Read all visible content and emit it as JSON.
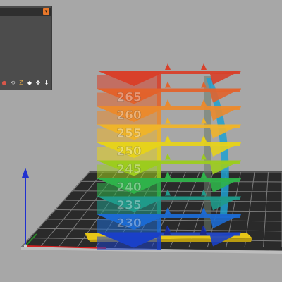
{
  "panel": {
    "dropdown_arrow_icon": "chevron-down-icon",
    "toolbar": [
      {
        "name": "object-icon"
      },
      {
        "name": "rotate-icon"
      },
      {
        "name": "scale-icon"
      },
      {
        "name": "cube-view-icon"
      },
      {
        "name": "move-icon"
      },
      {
        "name": "arrow-down-icon"
      }
    ]
  },
  "model": {
    "labels": [
      "265",
      "260",
      "255",
      "250",
      "245",
      "240",
      "235",
      "230"
    ]
  },
  "colors": {
    "background": "#a7a7a7",
    "bed": "#2a2a2a",
    "grid_lines": "#8a8a8a",
    "axis_x": "#d42020",
    "axis_y": "#2a8a2a",
    "axis_z": "#2030d0"
  }
}
